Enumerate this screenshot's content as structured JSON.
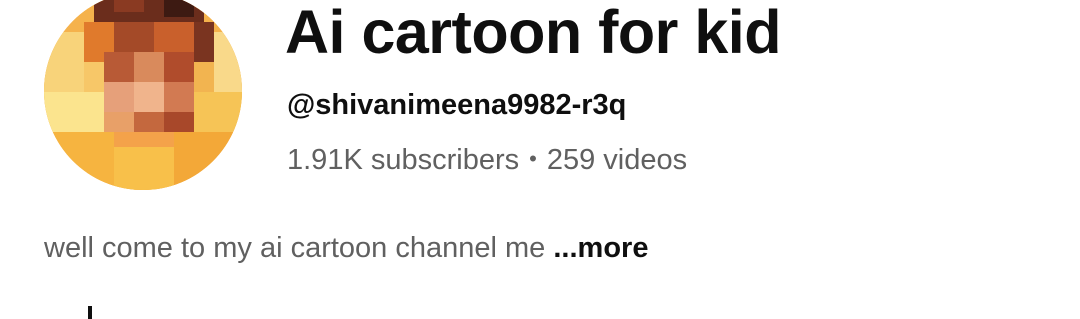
{
  "channel": {
    "name": "Ai cartoon for kid",
    "handle": "@shivanimeena9982-r3q",
    "subscribers": "1.91K subscribers",
    "separator": "•",
    "videos": "259 videos",
    "description": "well come to my ai cartoon channel me",
    "more_label": "...more"
  },
  "avatar": {
    "icon": "channel-avatar-pixelated",
    "colors": {
      "background": "#f3a640",
      "highlight": "#fbe28a",
      "hair": "#5a2a1c"
    }
  },
  "colors": {
    "primary_text": "#0f0f0f",
    "secondary_text": "#606060",
    "background": "#ffffff"
  }
}
